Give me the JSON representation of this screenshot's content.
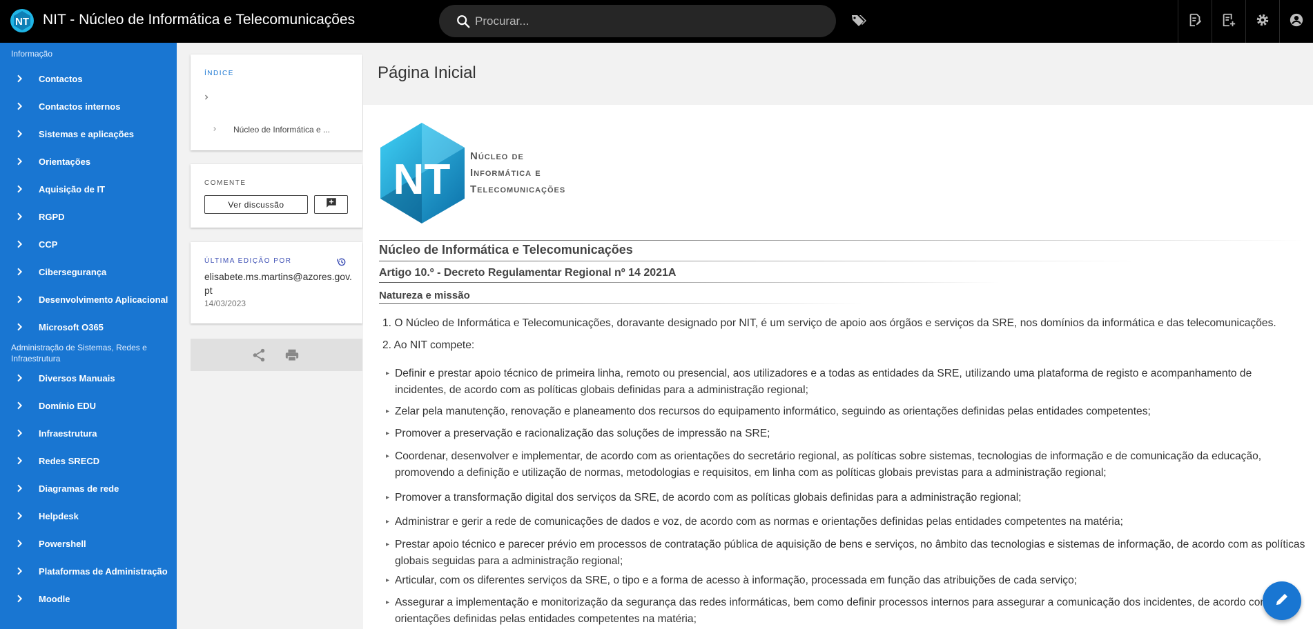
{
  "app": {
    "title": "NIT - Núcleo de Informática e Telecomunicações",
    "logo_text": "NT"
  },
  "search": {
    "placeholder": "Procurar..."
  },
  "colors": {
    "accent": "#1976d2",
    "topbar": "#000000",
    "logo_cyan": "#1fb5e6"
  },
  "top_actions": [
    {
      "icon": "edit-page-icon"
    },
    {
      "icon": "new-page-icon"
    },
    {
      "icon": "gear-icon"
    },
    {
      "icon": "account-icon"
    }
  ],
  "sidebar": {
    "section1": "Informação",
    "section1_items": [
      "Contactos",
      "Contactos internos",
      "Sistemas e aplicações",
      "Orientações",
      "Aquisição de IT",
      "RGPD",
      "CCP",
      "Cibersegurança",
      "Desenvolvimento Aplicacional",
      "Microsoft O365"
    ],
    "section2": "Administração de Sistemas, Redes e Infraestrutura",
    "section2_items": [
      "Diversos Manuais",
      "Domínio EDU",
      "Infraestrutura",
      "Redes SRECD",
      "Diagramas de rede",
      "Helpdesk",
      "Powershell",
      "Plataformas de Administração",
      "Moodle"
    ]
  },
  "toc": {
    "label": "ÍNDICE",
    "item": "Núcleo de Informática e ..."
  },
  "comments": {
    "label": "COMENTE",
    "button": "Ver discussão"
  },
  "last_edit": {
    "label": "ÚLTIMA EDIÇÃO POR",
    "user": "elisabete.ms.martins@azores.gov.pt",
    "date": "14/03/2023"
  },
  "page": {
    "title": "Página Inicial",
    "logo_lines": [
      "Núcleo de",
      "Informática e",
      "Telecomunicações"
    ],
    "h2": "Núcleo de Informática e Telecomunicações",
    "h3": "Artigo 10.º - Decreto Regulamentar Regional nº 14 2021A",
    "h4": "Natureza e missão",
    "items": [
      "O Núcleo de Informática e Telecomunicações, doravante designado por NIT, é um serviço de apoio aos órgãos e serviços da SRE, nos domínios da informática e das telecomunicações.",
      "Ao NIT compete:"
    ],
    "bullets": [
      "Definir e prestar apoio técnico de primeira linha, remoto ou presencial, aos utilizadores e a todas as entidades da SRE, utilizando uma plataforma de registo e acompanhamento de incidentes, de acordo com as políticas globais definidas para a administração regional;",
      "Zelar pela manutenção, renovação e planeamento dos recursos do equipamento informático, seguindo as orientações definidas pelas entidades competentes;",
      "Promover a preservação e racionalização das soluções de impressão na SRE;",
      "Coordenar, desenvolver e implementar, de acordo com as orientações do secretário regional, as políticas sobre sistemas, tecnologias de informação e de comunicação da educação, promovendo a definição e utilização de normas, metodologias e requisitos, em linha com as políticas globais previstas para a administração regional;",
      "Promover a transformação digital dos serviços da SRE, de acordo com as políticas globais definidas para a administração regional;",
      "Administrar e gerir a rede de comunicações de dados e voz, de acordo com as normas e orientações definidas pelas entidades competentes na matéria;",
      "Prestar apoio técnico e parecer prévio em processos de contratação pública de aquisição de bens e serviços, no âmbito das tecnologias e sistemas de informação, de acordo com as políticas globais seguidas para a administração regional;",
      "Articular, com os diferentes serviços da SRE, o tipo e a forma de acesso à informação, processada em função das atribuições de cada serviço;",
      "Assegurar a implementação e monitorização da segurança das redes informáticas, bem como definir processos internos para assegurar a comunicação dos incidentes, de acordo com as orientações definidas pelas entidades competentes na matéria;"
    ]
  }
}
